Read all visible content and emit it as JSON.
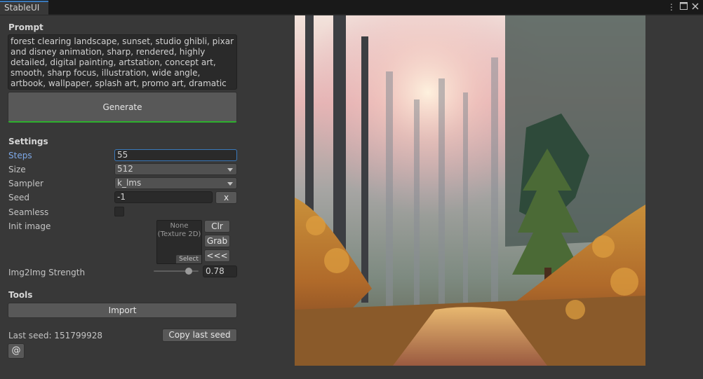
{
  "window": {
    "tab_title": "StableUI",
    "menu_icon": "kebab-menu-icon",
    "maximize_icon": "maximize-icon",
    "close_icon": "close-icon"
  },
  "prompt": {
    "heading": "Prompt",
    "text": "forest clearing landscape, sunset, studio ghibli, pixar and disney animation, sharp, rendered, highly detailed, digital painting, artstation, concept art, smooth, sharp focus, illustration, wide angle, artbook, wallpaper, splash art, promo art, dramatic lighting, art by artgerm and greg",
    "generate_label": "Generate"
  },
  "settings": {
    "heading": "Settings",
    "steps_label": "Steps",
    "steps_value": "55",
    "size_label": "Size",
    "size_value": "512",
    "sampler_label": "Sampler",
    "sampler_value": "k_lms",
    "seed_label": "Seed",
    "seed_value": "-1",
    "seed_clear_label": "x",
    "seamless_label": "Seamless",
    "seamless_checked": false,
    "init_image_label": "Init image",
    "texture_none": "None",
    "texture_type": "(Texture 2D)",
    "texture_select": "Select",
    "clr_label": "Clr",
    "grab_label": "Grab",
    "back_label": "<<<",
    "strength_label": "Img2Img Strength",
    "strength_value": "0.78"
  },
  "tools": {
    "heading": "Tools",
    "import_label": "Import",
    "last_seed_text": "Last seed: 151799928",
    "copy_seed_label": "Copy last seed",
    "at_label": "@"
  },
  "preview": {
    "description_icon": "generated-image"
  },
  "colors": {
    "accent_blue": "#3a79bb",
    "generate_underline": "#2db02d",
    "panel_bg": "#383838"
  }
}
